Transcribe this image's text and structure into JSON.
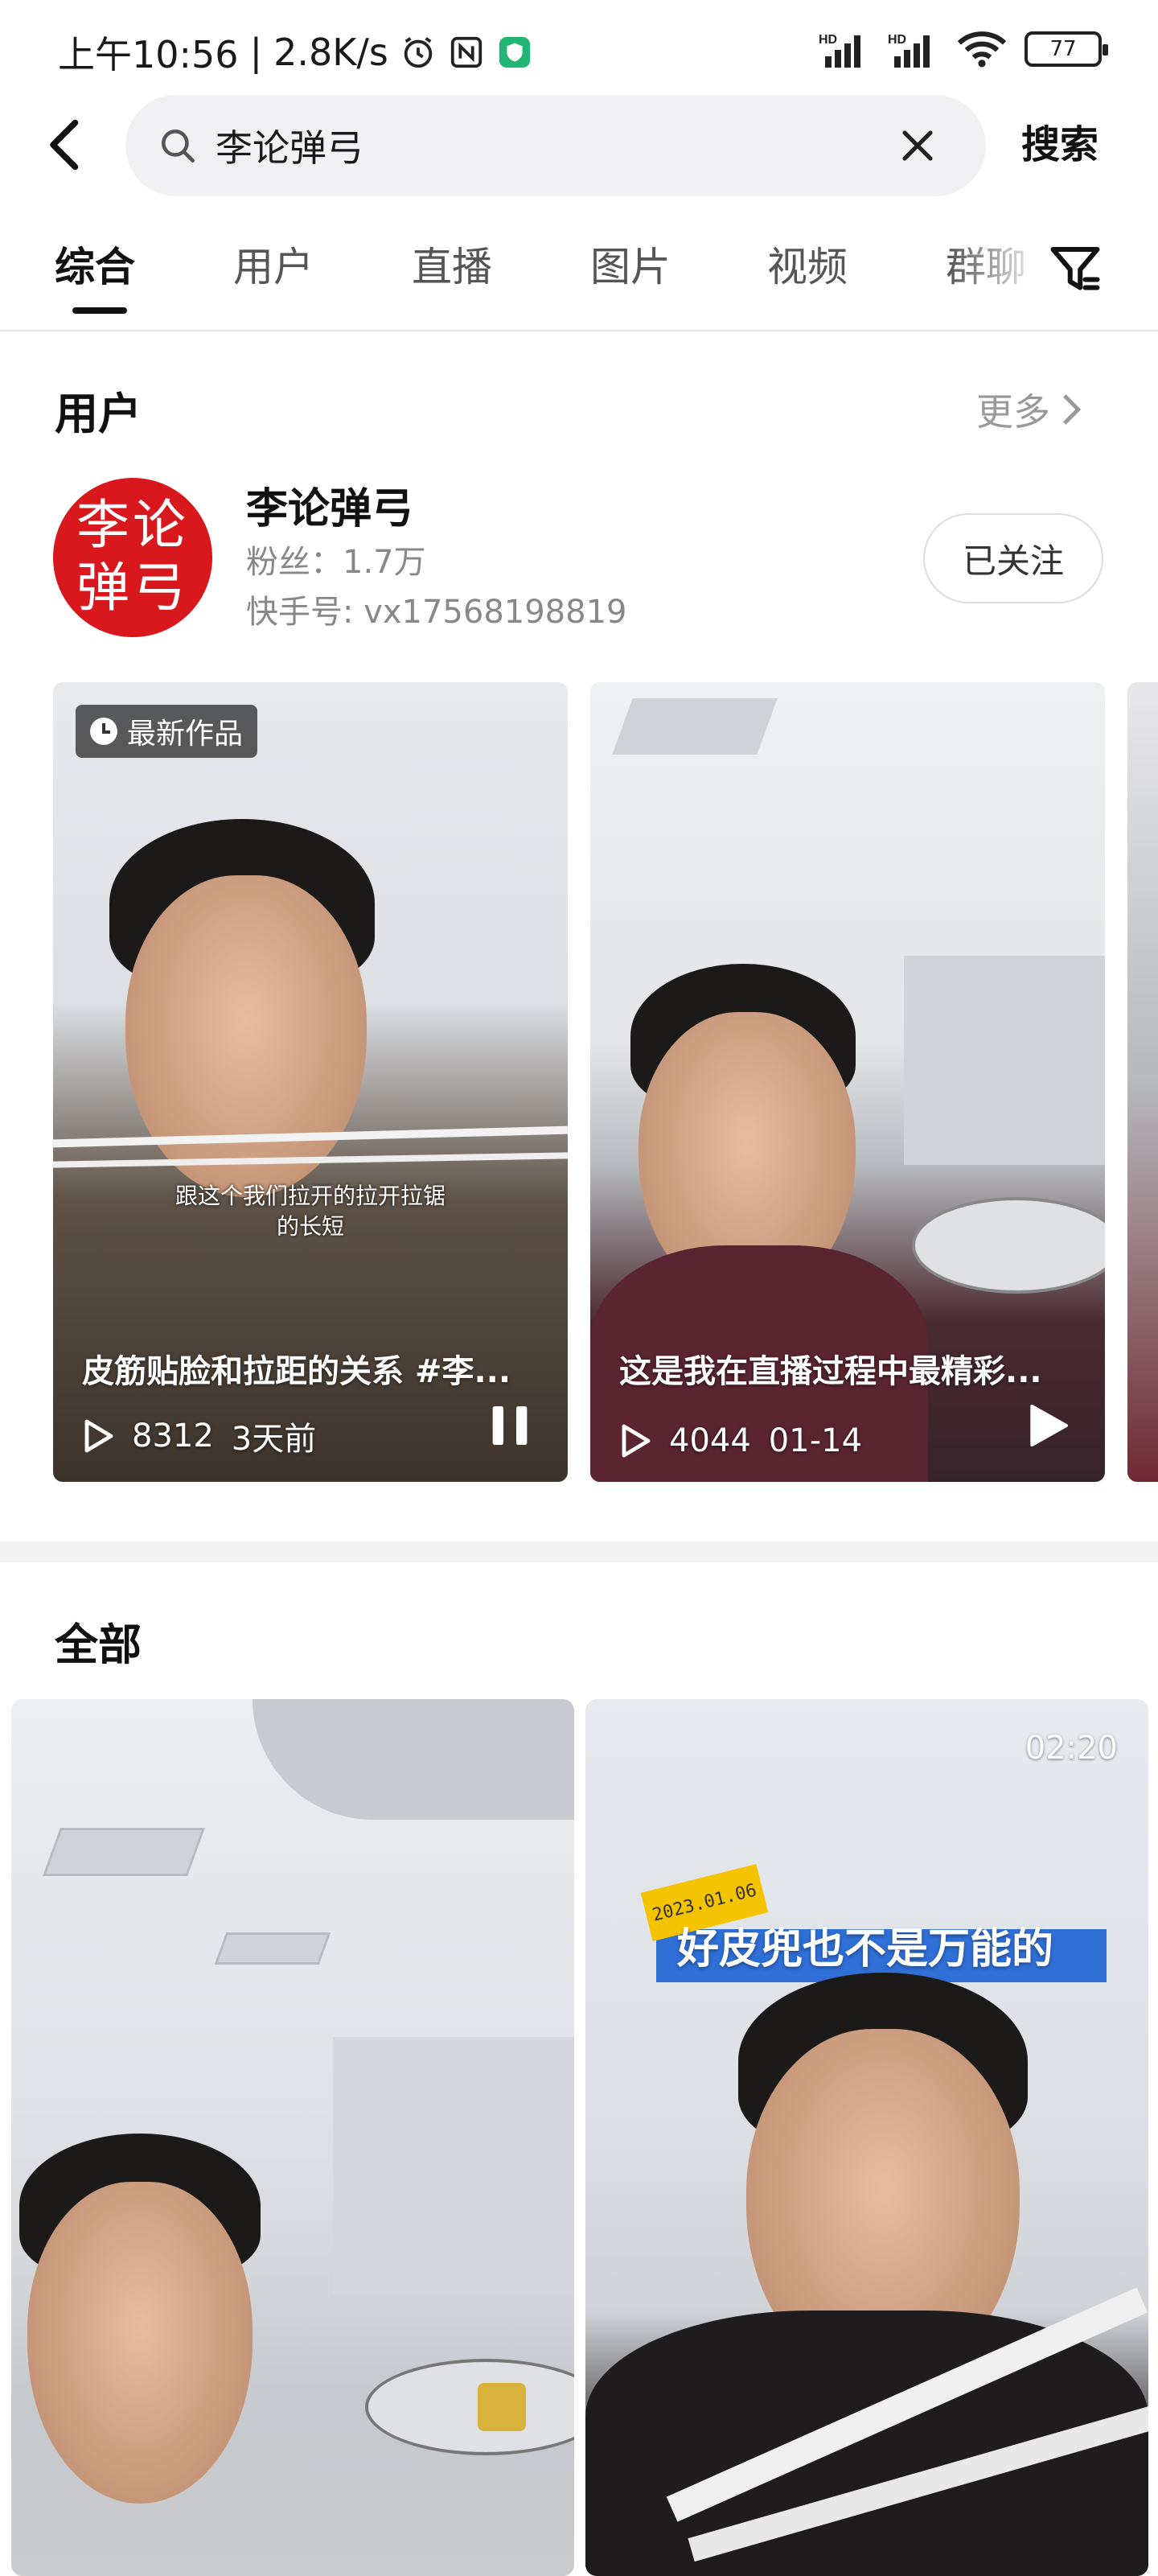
{
  "status_bar": {
    "time": "上午10:56",
    "speed": "2.8K/s",
    "battery": "77",
    "signal_1": "HD",
    "signal_2": "HD"
  },
  "search": {
    "query": "李论弹弓",
    "search_label": "搜索"
  },
  "tabs": [
    {
      "label": "综合",
      "active": true
    },
    {
      "label": "用户",
      "active": false
    },
    {
      "label": "直播",
      "active": false
    },
    {
      "label": "图片",
      "active": false
    },
    {
      "label": "视频",
      "active": false
    },
    {
      "label": "群聊",
      "active": false
    }
  ],
  "users_section": {
    "title": "用户",
    "more_label": "更多",
    "user": {
      "avatar_text": "李论弹弓",
      "name": "李论弹弓",
      "fans": "粉丝：1.7万",
      "kuaishou_id": "快手号: vx17568198819",
      "follow_label": "已关注"
    },
    "videos": [
      {
        "badge": "最新作品",
        "subtitle": "跟这个我们拉开的拉开拉锯\n的长短",
        "title": "皮筋贴脸和拉距的关系 #李...",
        "plays": "8312",
        "date": "3天前",
        "control": "pause-icon"
      },
      {
        "title": "这是我在直播过程中最精彩...",
        "plays": "4044",
        "date": "01-14",
        "control": "play-icon"
      }
    ]
  },
  "all_section": {
    "title": "全部",
    "videos": [
      {
        "duration": ""
      },
      {
        "duration": "02:20",
        "date_tag": "2023.01.06",
        "caption": "好皮兜也不是万能的"
      }
    ]
  },
  "colors": {
    "avatar_bg": "#d8181d",
    "caption_bar": "#2f6fd6",
    "date_tag": "#f5c400"
  }
}
